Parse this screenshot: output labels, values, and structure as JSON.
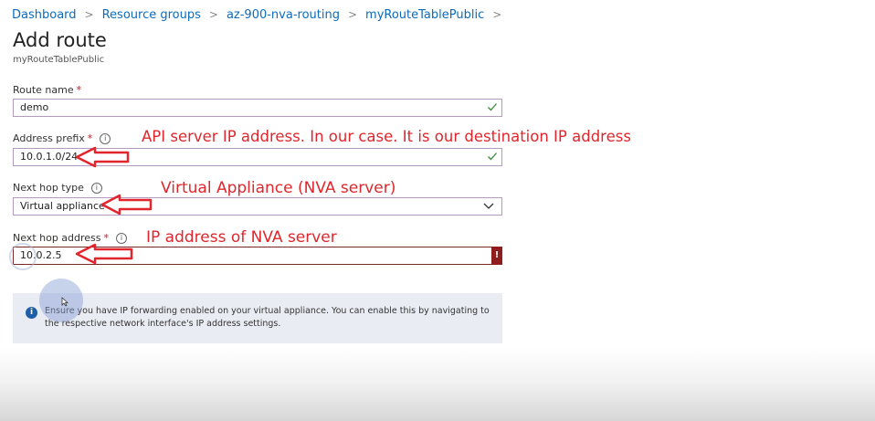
{
  "breadcrumb": [
    "Dashboard",
    "Resource groups",
    "az-900-nva-routing",
    "myRouteTablePublic"
  ],
  "page": {
    "title": "Add route",
    "subtitle": "myRouteTablePublic"
  },
  "form": {
    "route_name": {
      "label": "Route name",
      "required_mark": "*",
      "value": "demo"
    },
    "address_prefix": {
      "label": "Address prefix",
      "required_mark": "*",
      "value": "10.0.1.0/24"
    },
    "next_hop_type": {
      "label": "Next hop type",
      "value": "Virtual appliance"
    },
    "next_hop_address": {
      "label": "Next hop address",
      "required_mark": "*",
      "value": "10.0.2.5",
      "error_mark": "!"
    }
  },
  "annotations": {
    "address_prefix": "API server IP address. In our case. It is our destination IP address",
    "next_hop_type": "Virtual Appliance (NVA server)",
    "next_hop_address": "IP address of NVA server"
  },
  "info_bar": {
    "icon": "i",
    "text": "Ensure you have IP forwarding enabled on your virtual appliance. You can enable this by navigating to the respective network interface's IP address settings."
  },
  "colors": {
    "link": "#0b6bbd",
    "annotation": "#e0262c",
    "error": "#8f1d1d",
    "info_icon": "#1f5fa8"
  }
}
